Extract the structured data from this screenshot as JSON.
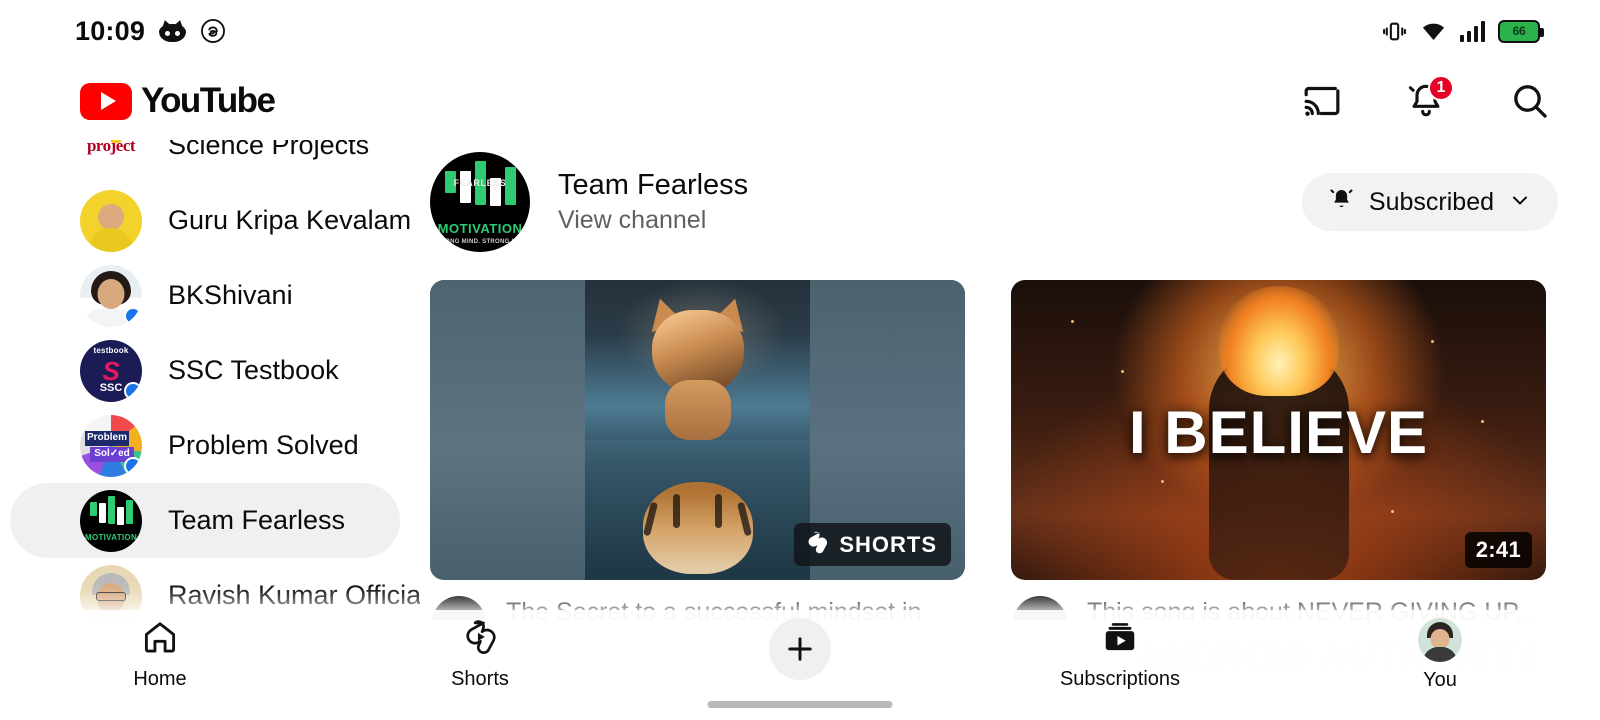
{
  "status_bar": {
    "time": "10:09",
    "left_icons": [
      "cat-icon",
      "threads-icon"
    ],
    "right_icons": [
      "vibrate-icon",
      "wifi-icon",
      "cellular-signal-icon",
      "battery-icon"
    ],
    "battery_level": "66"
  },
  "header": {
    "brand": "YouTube",
    "cast_label": "cast-icon",
    "notifications_label": "notifications-bell-icon",
    "notification_count": "1",
    "search_label": "search-icon"
  },
  "sidebar": {
    "items": [
      {
        "label": "Science Projects",
        "avatar": "science",
        "unread": false,
        "selected": false
      },
      {
        "label": "Guru Kripa Kevalam",
        "avatar": "guru",
        "unread": false,
        "selected": false
      },
      {
        "label": "BKShivani",
        "avatar": "bkshivani",
        "unread": true,
        "selected": false
      },
      {
        "label": "SSC Testbook",
        "avatar": "ssc",
        "unread": true,
        "selected": false
      },
      {
        "label": "Problem Solved",
        "avatar": "problem",
        "unread": true,
        "selected": false
      },
      {
        "label": "Team Fearless",
        "avatar": "fearless",
        "unread": false,
        "selected": true
      },
      {
        "label": "Ravish Kumar Official",
        "avatar": "ravish",
        "unread": false,
        "selected": false
      }
    ]
  },
  "channel": {
    "name": "Team Fearless",
    "view_channel": "View channel",
    "avatar_title": "FEARLESS",
    "avatar_subtitle": "MOTIVATION",
    "avatar_tagline": "STRONG MIND. STRONG LIFE.",
    "subscribe_button": "Subscribed",
    "subscribe_state": "subscribed"
  },
  "videos": [
    {
      "badge": "SHORTS",
      "badge_type": "shorts",
      "thumbnail": "kitten-tiger-reflection",
      "title": "The Secret to a successful mindset in the English..."
    },
    {
      "badge": "2:41",
      "badge_type": "duration",
      "thumbnail": "fire-warrior-i-believe",
      "thumbnail_text": "I BELIEVE",
      "title": "This song is about NEVER GIVING UP..."
    }
  ],
  "bottom_nav": {
    "items": [
      {
        "label": "Home",
        "icon": "home-icon"
      },
      {
        "label": "Shorts",
        "icon": "shorts-icon"
      },
      {
        "label": "",
        "icon": "plus-icon"
      },
      {
        "label": "Subscriptions",
        "icon": "subscriptions-icon"
      },
      {
        "label": "You",
        "icon": "avatar-icon"
      }
    ]
  },
  "watermark": "ANDROID AUTHORITY",
  "colors": {
    "youtube_red": "#ff0000",
    "badge_red": "#e60023",
    "unread_blue": "#1a73e8",
    "selected_gray": "#f0f0f0",
    "battery_green": "#2bb24c"
  }
}
